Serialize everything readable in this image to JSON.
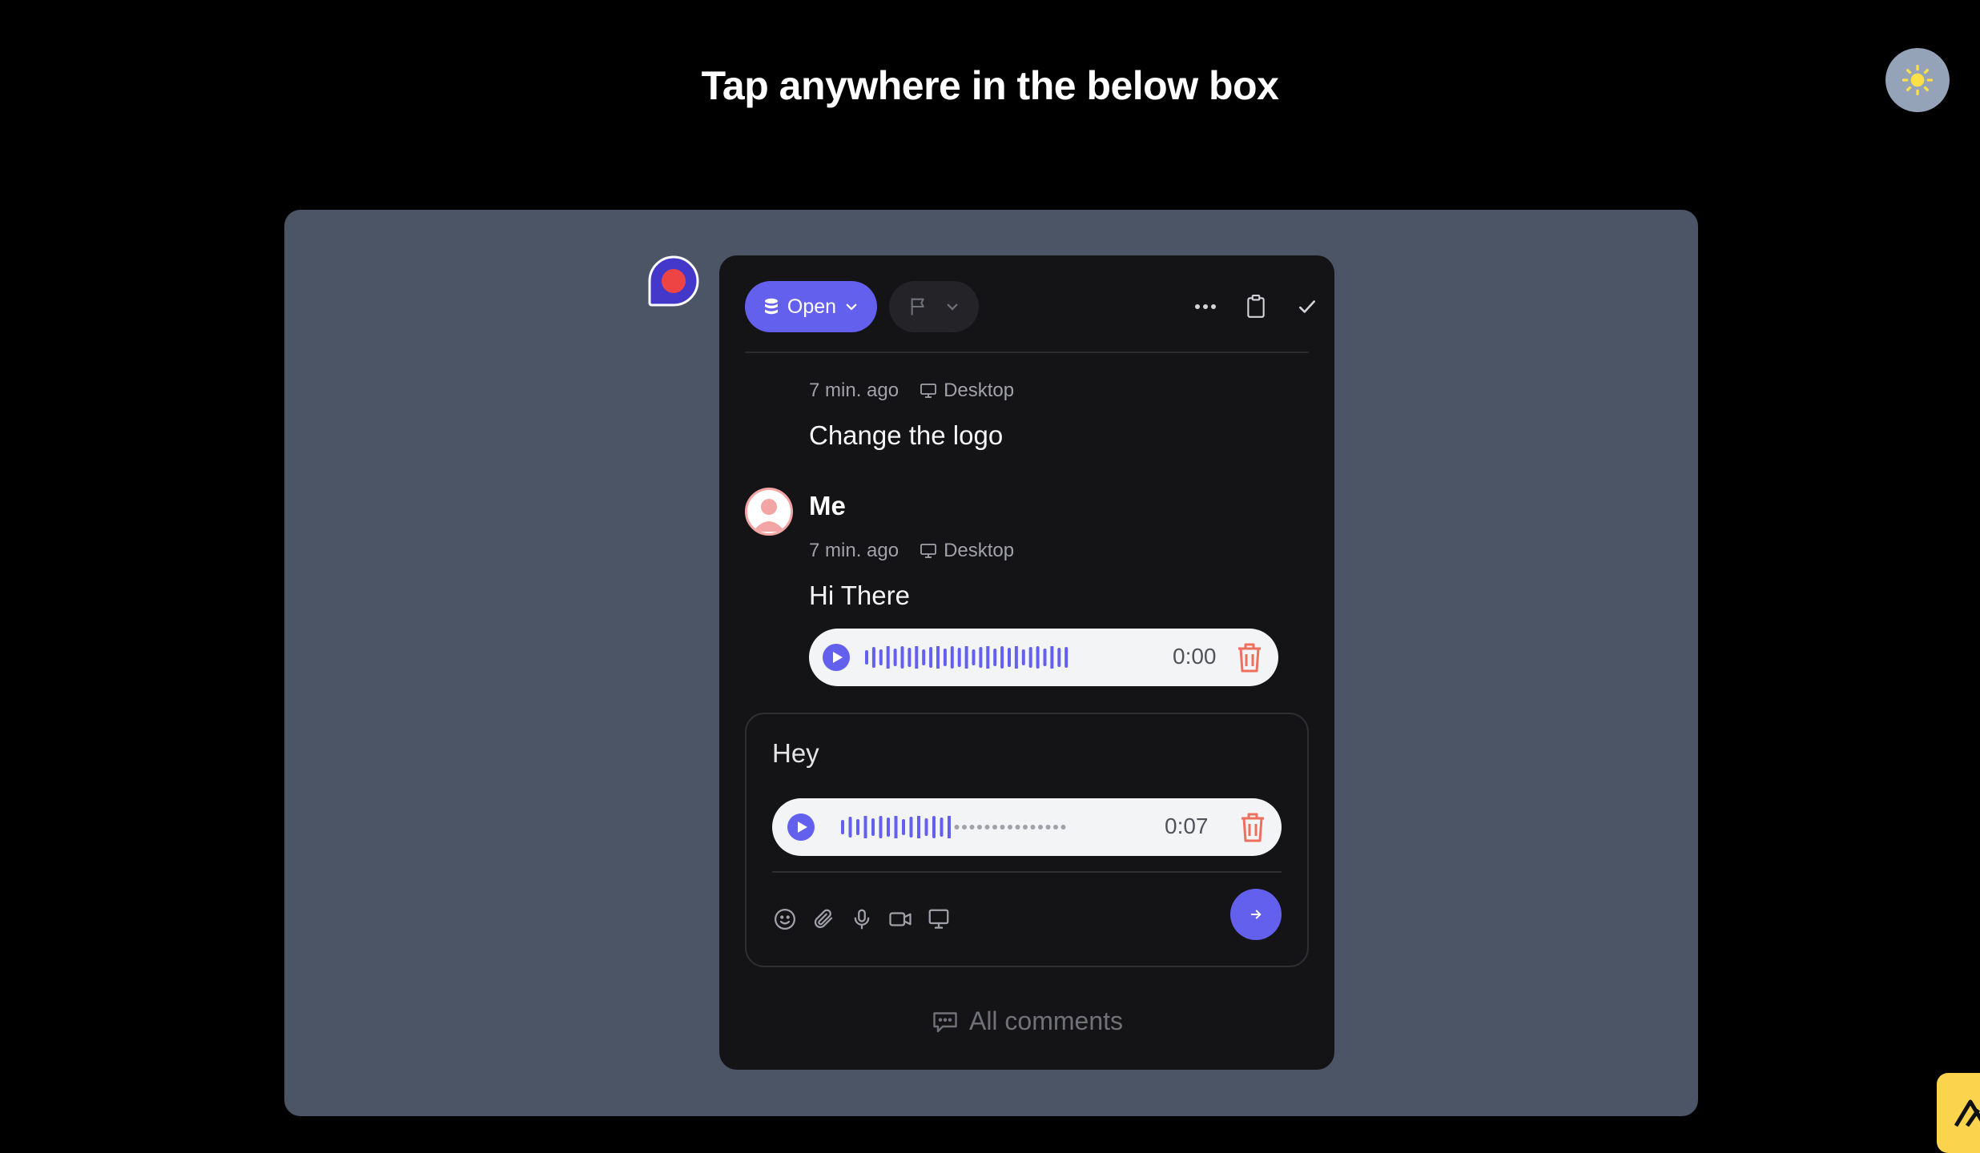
{
  "page": {
    "title": "Tap anywhere in the below box"
  },
  "colors": {
    "accent": "#6360ee",
    "danger": "#ef6f5e",
    "canvas": "#4b5565",
    "panel": "#141416"
  },
  "toolbar": {
    "status_label": "Open",
    "icons": [
      "database-icon",
      "chevron-down-icon",
      "flag-icon",
      "more-icon",
      "clipboard-icon",
      "check-icon"
    ]
  },
  "thread": {
    "comments": [
      {
        "author": "",
        "time": "7 min. ago",
        "device": "Desktop",
        "text": "Change the logo"
      },
      {
        "author": "Me",
        "time": "7 min. ago",
        "device": "Desktop",
        "text": "Hi There",
        "audio": {
          "duration": "0:00",
          "progress": 1.0
        }
      }
    ]
  },
  "composer": {
    "value": "Hey",
    "audio": {
      "duration": "0:07",
      "progress": 0.5
    },
    "tools": [
      "emoji-icon",
      "attachment-icon",
      "microphone-icon",
      "video-icon",
      "screen-icon"
    ]
  },
  "footer": {
    "all_comments_label": "All comments"
  }
}
